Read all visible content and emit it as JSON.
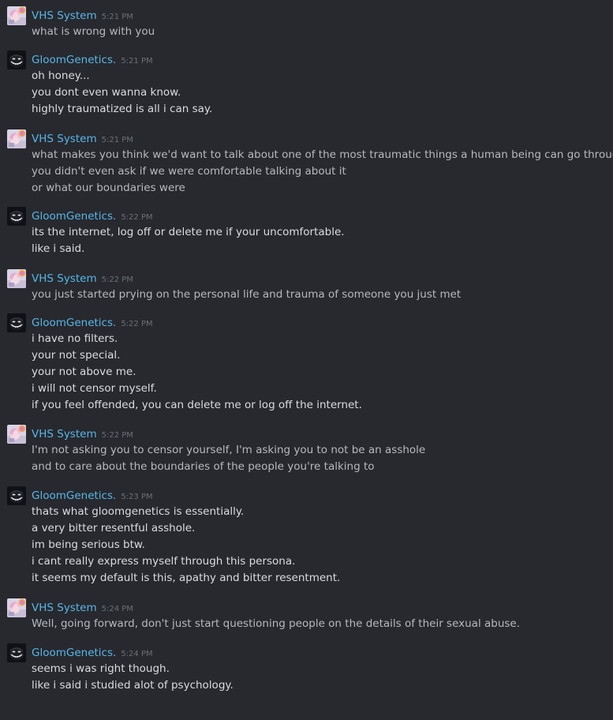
{
  "colors": {
    "background": "#27292e",
    "username": "#58b6e8",
    "timestamp": "#6b6f76",
    "vhs_text": "#b6b9bf",
    "gloom_text": "#dadcdf"
  },
  "messages": [
    {
      "author": "VHS System",
      "avatar_icon": "vhs-system-avatar-icon",
      "time": "5:21 PM",
      "lines": [
        "what is wrong with you"
      ]
    },
    {
      "author": "GloomGenetics.",
      "avatar_icon": "gloomgenetics-avatar-icon",
      "time": "5:21 PM",
      "lines": [
        "oh honey...",
        "you dont even wanna know.",
        "highly traumatized is all i can say."
      ]
    },
    {
      "author": "VHS System",
      "avatar_icon": "vhs-system-avatar-icon",
      "time": "5:21 PM",
      "lines": [
        "what makes you think we'd want to talk about one of the most traumatic things a human being can go through",
        "you didn't even ask if we were comfortable talking about it",
        "or what our boundaries were"
      ]
    },
    {
      "author": "GloomGenetics.",
      "avatar_icon": "gloomgenetics-avatar-icon",
      "time": "5:22 PM",
      "lines": [
        "its the internet, log off or delete me if your uncomfortable.",
        "like i said."
      ]
    },
    {
      "author": "VHS System",
      "avatar_icon": "vhs-system-avatar-icon",
      "time": "5:22 PM",
      "lines": [
        "you just started prying on the personal life and trauma of someone you just met"
      ]
    },
    {
      "author": "GloomGenetics.",
      "avatar_icon": "gloomgenetics-avatar-icon",
      "time": "5:22 PM",
      "lines": [
        "i have no filters.",
        "your not special.",
        "your not above me.",
        "i will not censor myself.",
        "if you feel offended, you can delete me or log off the internet."
      ]
    },
    {
      "author": "VHS System",
      "avatar_icon": "vhs-system-avatar-icon",
      "time": "5:22 PM",
      "lines": [
        "I'm not asking you to censor yourself, I'm asking you to not be an asshole",
        "and to care about the boundaries of the people you're talking to"
      ]
    },
    {
      "author": "GloomGenetics.",
      "avatar_icon": "gloomgenetics-avatar-icon",
      "time": "5:23 PM",
      "lines": [
        "thats what gloomgenetics is essentially.",
        "a very bitter resentful asshole.",
        "im being serious btw.",
        "i cant really express myself through this persona.",
        "it seems my default is this, apathy and bitter resentment."
      ]
    },
    {
      "author": "VHS System",
      "avatar_icon": "vhs-system-avatar-icon",
      "time": "5:24 PM",
      "lines": [
        "Well, going forward, don't just start questioning people on the details of their sexual abuse."
      ]
    },
    {
      "author": "GloomGenetics.",
      "avatar_icon": "gloomgenetics-avatar-icon",
      "time": "5:24 PM",
      "lines": [
        "seems i was right though.",
        "like i said i studied alot of psychology."
      ]
    }
  ]
}
